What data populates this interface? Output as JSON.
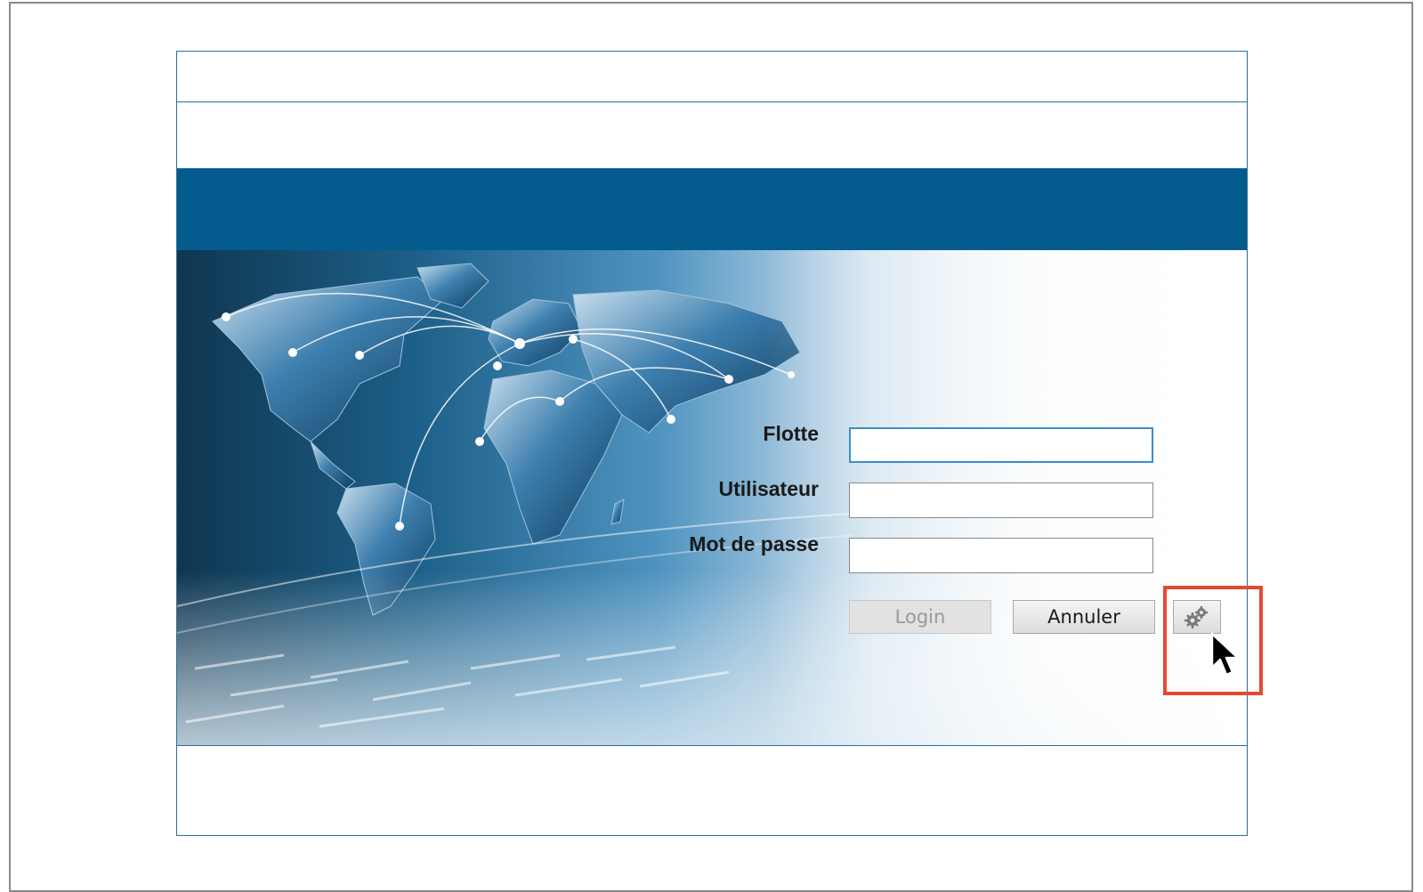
{
  "form": {
    "fleet_label": "Flotte",
    "fleet_value": "",
    "user_label": "Utilisateur",
    "user_value": "",
    "password_label": "Mot de passe",
    "password_value": ""
  },
  "buttons": {
    "login_label": "Login",
    "cancel_label": "Annuler",
    "settings_icon": "gears-icon"
  },
  "colors": {
    "header_band": "#045b8e",
    "window_border": "#2a6e97",
    "highlight": "#e34a2e",
    "focus_border": "#3c8dc8"
  }
}
